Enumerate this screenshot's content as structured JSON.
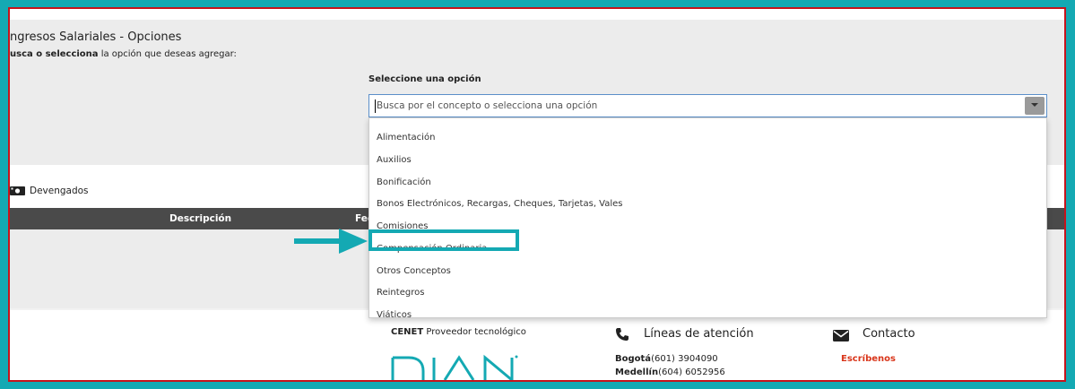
{
  "header": {
    "title": "ngresos Salariales - Opciones",
    "subtitle_bold": "usca o selecciona",
    "subtitle_rest": " la opción que deseas agregar:"
  },
  "select": {
    "label": "Seleccione una opción",
    "placeholder": "Busca por el concepto o selecciona una opción",
    "options": [
      "Alimentación",
      "Auxilios",
      "Bonificación",
      "Bonos Electrónicos, Recargas, Cheques, Tarjetas, Vales",
      "Comisiones",
      "Compensación Ordinaria",
      "Otros Conceptos",
      "Reintegros",
      "Viáticos"
    ],
    "highlighted_index": 5
  },
  "devengados": {
    "label": "Devengados",
    "columns": [
      "Descripción",
      "Fec"
    ]
  },
  "footer": {
    "cenet_bold": "CENET",
    "cenet_rest": " Proveedor tecnológico",
    "lineas": "Líneas de atención",
    "contacto": "Contacto",
    "escribenos": "Escríbenos",
    "phones": [
      {
        "city": "Bogotá",
        "number": "(601) 3904090"
      },
      {
        "city": "Medellín",
        "number": "(604) 6052956"
      }
    ],
    "logo_text": "DIAN"
  },
  "colors": {
    "accent": "#14a9b3",
    "frame_border": "#c7131b",
    "link": "#d9361b"
  }
}
